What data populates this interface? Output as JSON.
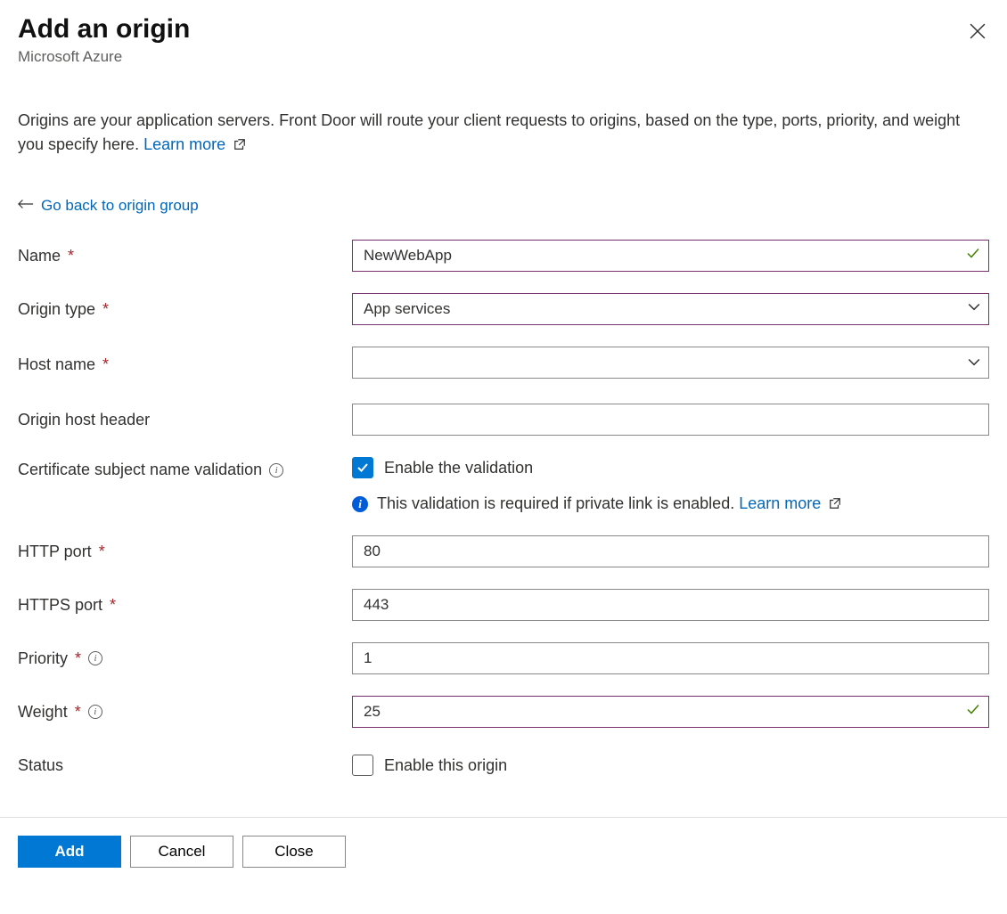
{
  "header": {
    "title": "Add an origin",
    "subtitle": "Microsoft Azure"
  },
  "intro": {
    "text": "Origins are your application servers. Front Door will route your client requests to origins, based on the type, ports, priority, and weight you specify here. ",
    "learn_more": "Learn more"
  },
  "back_link": "Go back to origin group",
  "form": {
    "name": {
      "label": "Name",
      "value": "NewWebApp"
    },
    "origin_type": {
      "label": "Origin type",
      "value": "App services"
    },
    "host_name": {
      "label": "Host name",
      "value": ""
    },
    "origin_host_header": {
      "label": "Origin host header",
      "value": ""
    },
    "cert_validation": {
      "label": "Certificate subject name validation",
      "checkbox_label": "Enable the validation",
      "checked": true,
      "info_text": "This validation is required if private link is enabled. ",
      "info_link": "Learn more"
    },
    "http_port": {
      "label": "HTTP port",
      "value": "80"
    },
    "https_port": {
      "label": "HTTPS port",
      "value": "443"
    },
    "priority": {
      "label": "Priority",
      "value": "1"
    },
    "weight": {
      "label": "Weight",
      "value": "25"
    },
    "status": {
      "label": "Status",
      "checkbox_label": "Enable this origin",
      "checked": false
    }
  },
  "buttons": {
    "add": "Add",
    "cancel": "Cancel",
    "close": "Close"
  }
}
